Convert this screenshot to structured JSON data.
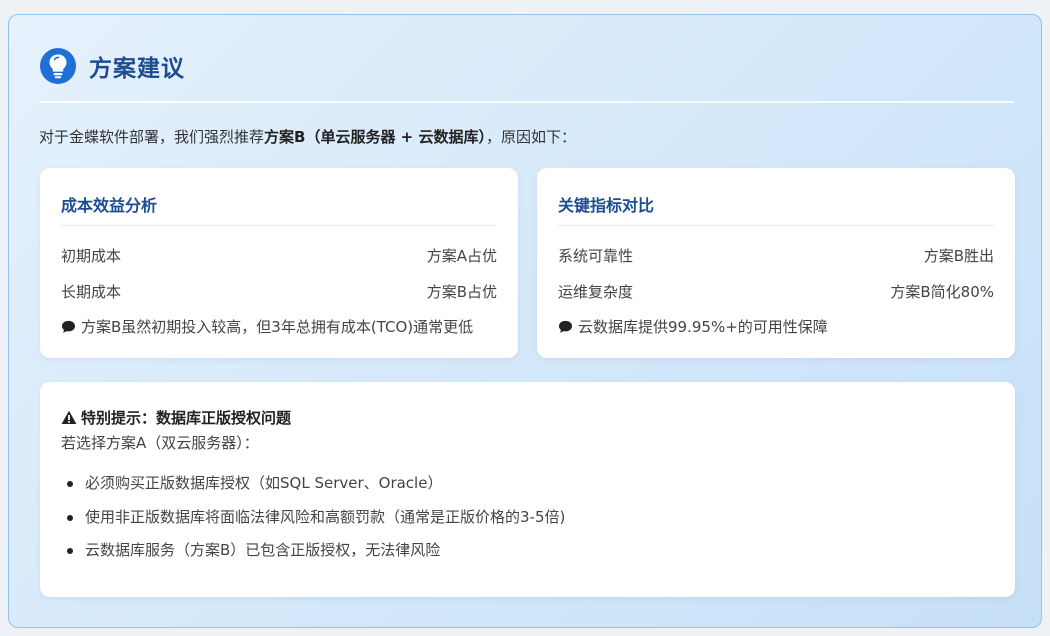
{
  "header": {
    "icon": "lightbulb-icon",
    "title": "方案建议",
    "accent_color": "#1e4d8f"
  },
  "intro": {
    "prefix": "对于金蝶软件部署，我们强烈推荐",
    "highlight": "方案B（单云服务器 + 云数据库）",
    "suffix": "，原因如下："
  },
  "cost_card": {
    "title": "成本效益分析",
    "rows": [
      {
        "label": "初期成本",
        "value": "方案A占优"
      },
      {
        "label": "长期成本",
        "value": "方案B占优"
      }
    ],
    "note_icon": "comment-icon",
    "note": "方案B虽然初期投入较高，但3年总拥有成本(TCO)通常更低"
  },
  "metrics_card": {
    "title": "关键指标对比",
    "rows": [
      {
        "label": "系统可靠性",
        "value": "方案B胜出"
      },
      {
        "label": "运维复杂度",
        "value": "方案B简化80%"
      }
    ],
    "note_icon": "comment-icon",
    "note": "云数据库提供99.95%+的可用性保障"
  },
  "warning": {
    "icon": "warning-triangle-icon",
    "title": "特别提示：数据库正版授权问题",
    "subtitle": "若选择方案A（双云服务器）：",
    "items": [
      "必须购买正版数据库授权（如SQL Server、Oracle）",
      "使用非正版数据库将面临法律风险和高额罚款（通常是正版价格的3-5倍)",
      "云数据库服务（方案B）已包含正版授权，无法律风险"
    ]
  }
}
